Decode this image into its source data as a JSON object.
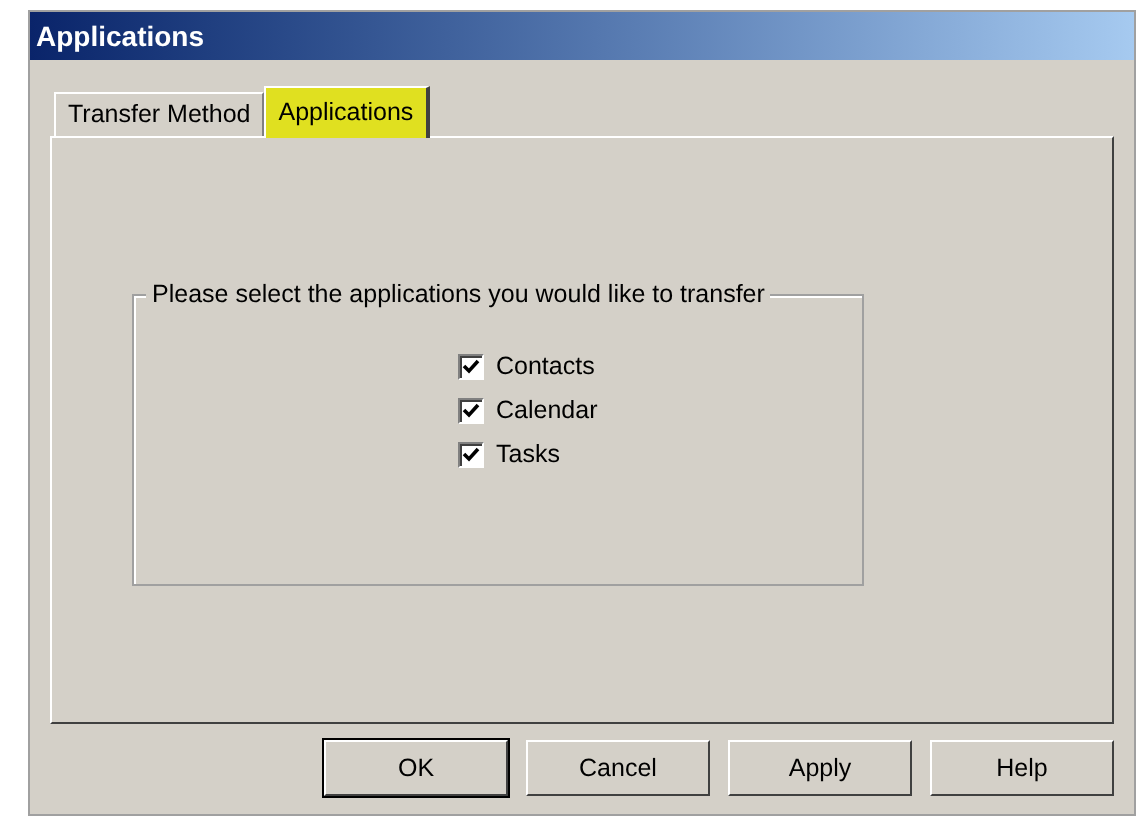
{
  "window": {
    "title": "Applications"
  },
  "tabs": [
    {
      "label": "Transfer Method",
      "selected": false,
      "highlighted": false
    },
    {
      "label": "Applications",
      "selected": true,
      "highlighted": true
    }
  ],
  "group": {
    "caption": "Please select the applications you would like to transfer",
    "items": [
      {
        "label": "Contacts",
        "checked": true
      },
      {
        "label": "Calendar",
        "checked": true
      },
      {
        "label": "Tasks",
        "checked": true
      }
    ]
  },
  "buttons": [
    {
      "label": "OK",
      "default": true
    },
    {
      "label": "Cancel",
      "default": false
    },
    {
      "label": "Apply",
      "default": false
    },
    {
      "label": "Help",
      "default": false
    }
  ]
}
